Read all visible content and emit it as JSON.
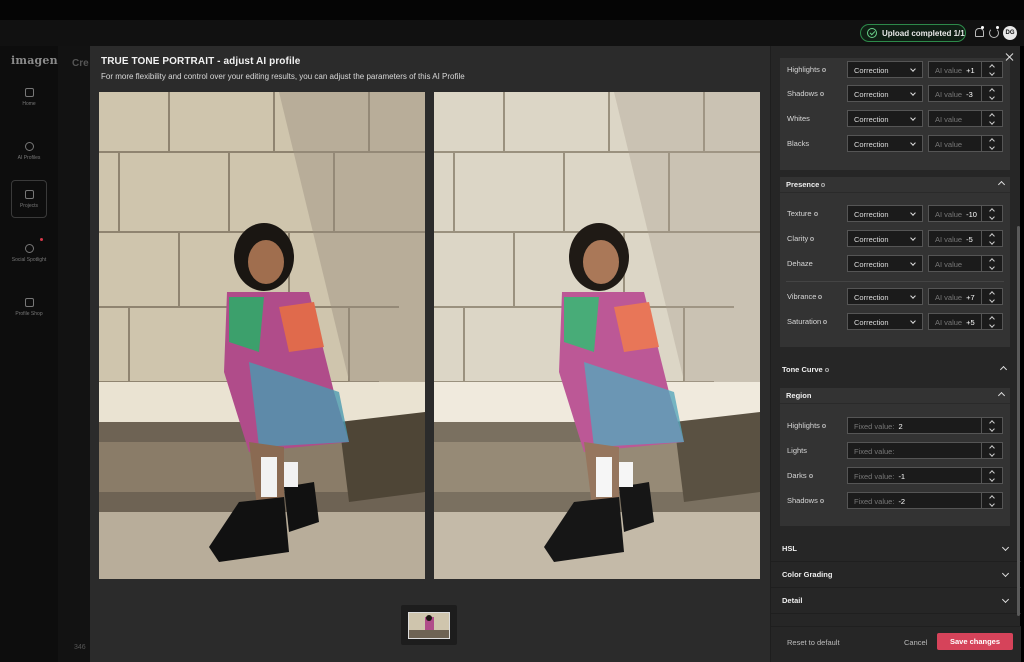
{
  "topbar": {
    "upload_status": "Upload completed 1/1",
    "avatar_initials": "DG"
  },
  "app": {
    "logo": "imagen",
    "page_title_partial": "Cre",
    "bottom_number_partial": "346",
    "nav": [
      {
        "label": "Home",
        "icon": "home-icon"
      },
      {
        "label": "AI Profiles",
        "icon": "ai-profiles-icon"
      },
      {
        "label": "Projects",
        "icon": "projects-icon"
      },
      {
        "label": "Social Spotlight",
        "icon": "social-icon"
      },
      {
        "label": "Profile Shop",
        "icon": "shop-icon"
      }
    ]
  },
  "modal": {
    "title": "TRUE TONE PORTRAIT - adjust AI profile",
    "subtitle": "For more flexibility and control over your editing results, you can adjust the parameters of this AI Profile"
  },
  "panel": {
    "light_rows": [
      {
        "label": "Highlights",
        "dot": true,
        "select": "Correction",
        "placeholder": "AI value",
        "value": "+1"
      },
      {
        "label": "Shadows",
        "dot": true,
        "select": "Correction",
        "placeholder": "AI value",
        "value": "-3"
      },
      {
        "label": "Whites",
        "dot": false,
        "select": "Correction",
        "placeholder": "AI value",
        "value": ""
      },
      {
        "label": "Blacks",
        "dot": false,
        "select": "Correction",
        "placeholder": "AI value",
        "value": ""
      }
    ],
    "presence": {
      "title": "Presence",
      "rows": [
        {
          "label": "Texture",
          "dot": true,
          "select": "Correction",
          "placeholder": "AI value",
          "value": "-10"
        },
        {
          "label": "Clarity",
          "dot": true,
          "select": "Correction",
          "placeholder": "AI value",
          "value": "-5"
        },
        {
          "label": "Dehaze",
          "dot": false,
          "select": "Correction",
          "placeholder": "AI value",
          "value": ""
        },
        {
          "label": "Vibrance",
          "dot": true,
          "select": "Correction",
          "placeholder": "AI value",
          "value": "+7"
        },
        {
          "label": "Saturation",
          "dot": true,
          "select": "Correction",
          "placeholder": "AI value",
          "value": "+5"
        }
      ]
    },
    "tone_curve": {
      "title": "Tone Curve"
    },
    "region": {
      "title": "Region",
      "rows": [
        {
          "label": "Highlights",
          "dot": true,
          "placeholder": "Fixed value:",
          "value": "2"
        },
        {
          "label": "Lights",
          "dot": false,
          "placeholder": "Fixed value:",
          "value": ""
        },
        {
          "label": "Darks",
          "dot": true,
          "placeholder": "Fixed value:",
          "value": "-1"
        },
        {
          "label": "Shadows",
          "dot": true,
          "placeholder": "Fixed value:",
          "value": "-2"
        }
      ]
    },
    "collapsed_sections": [
      "HSL",
      "Color Grading",
      "Detail"
    ],
    "footer": {
      "reset": "Reset to default",
      "cancel": "Cancel",
      "save": "Save changes"
    }
  },
  "colors": {
    "accent": "#d6435a",
    "success": "#2d8a4a"
  }
}
